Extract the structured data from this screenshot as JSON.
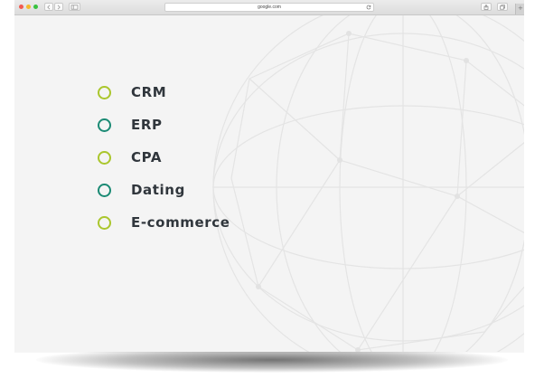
{
  "browser": {
    "address_text": "google.com",
    "traffic_lights": {
      "close": "#f25a4f",
      "minimize": "#f5b92b",
      "zoom": "#37c23f"
    },
    "add_tab_symbol": "+"
  },
  "menu": {
    "items": [
      {
        "label": "CRM",
        "ring_color": "#aac62c"
      },
      {
        "label": "ERP",
        "ring_color": "#1b8a74"
      },
      {
        "label": "CPA",
        "ring_color": "#aac62c"
      },
      {
        "label": "Dating",
        "ring_color": "#1b8a74"
      },
      {
        "label": "E-commerce",
        "ring_color": "#aac62c"
      }
    ]
  },
  "colors": {
    "accent_green": "#aac62c",
    "accent_teal": "#1b8a74",
    "text_dark": "#30363c",
    "background": "#f4f4f4"
  },
  "icons": [
    "back-chevron-icon",
    "forward-chevron-icon",
    "sidebar-icon",
    "reload-icon",
    "share-icon",
    "tabs-icon",
    "plus-icon",
    "globe-background"
  ]
}
